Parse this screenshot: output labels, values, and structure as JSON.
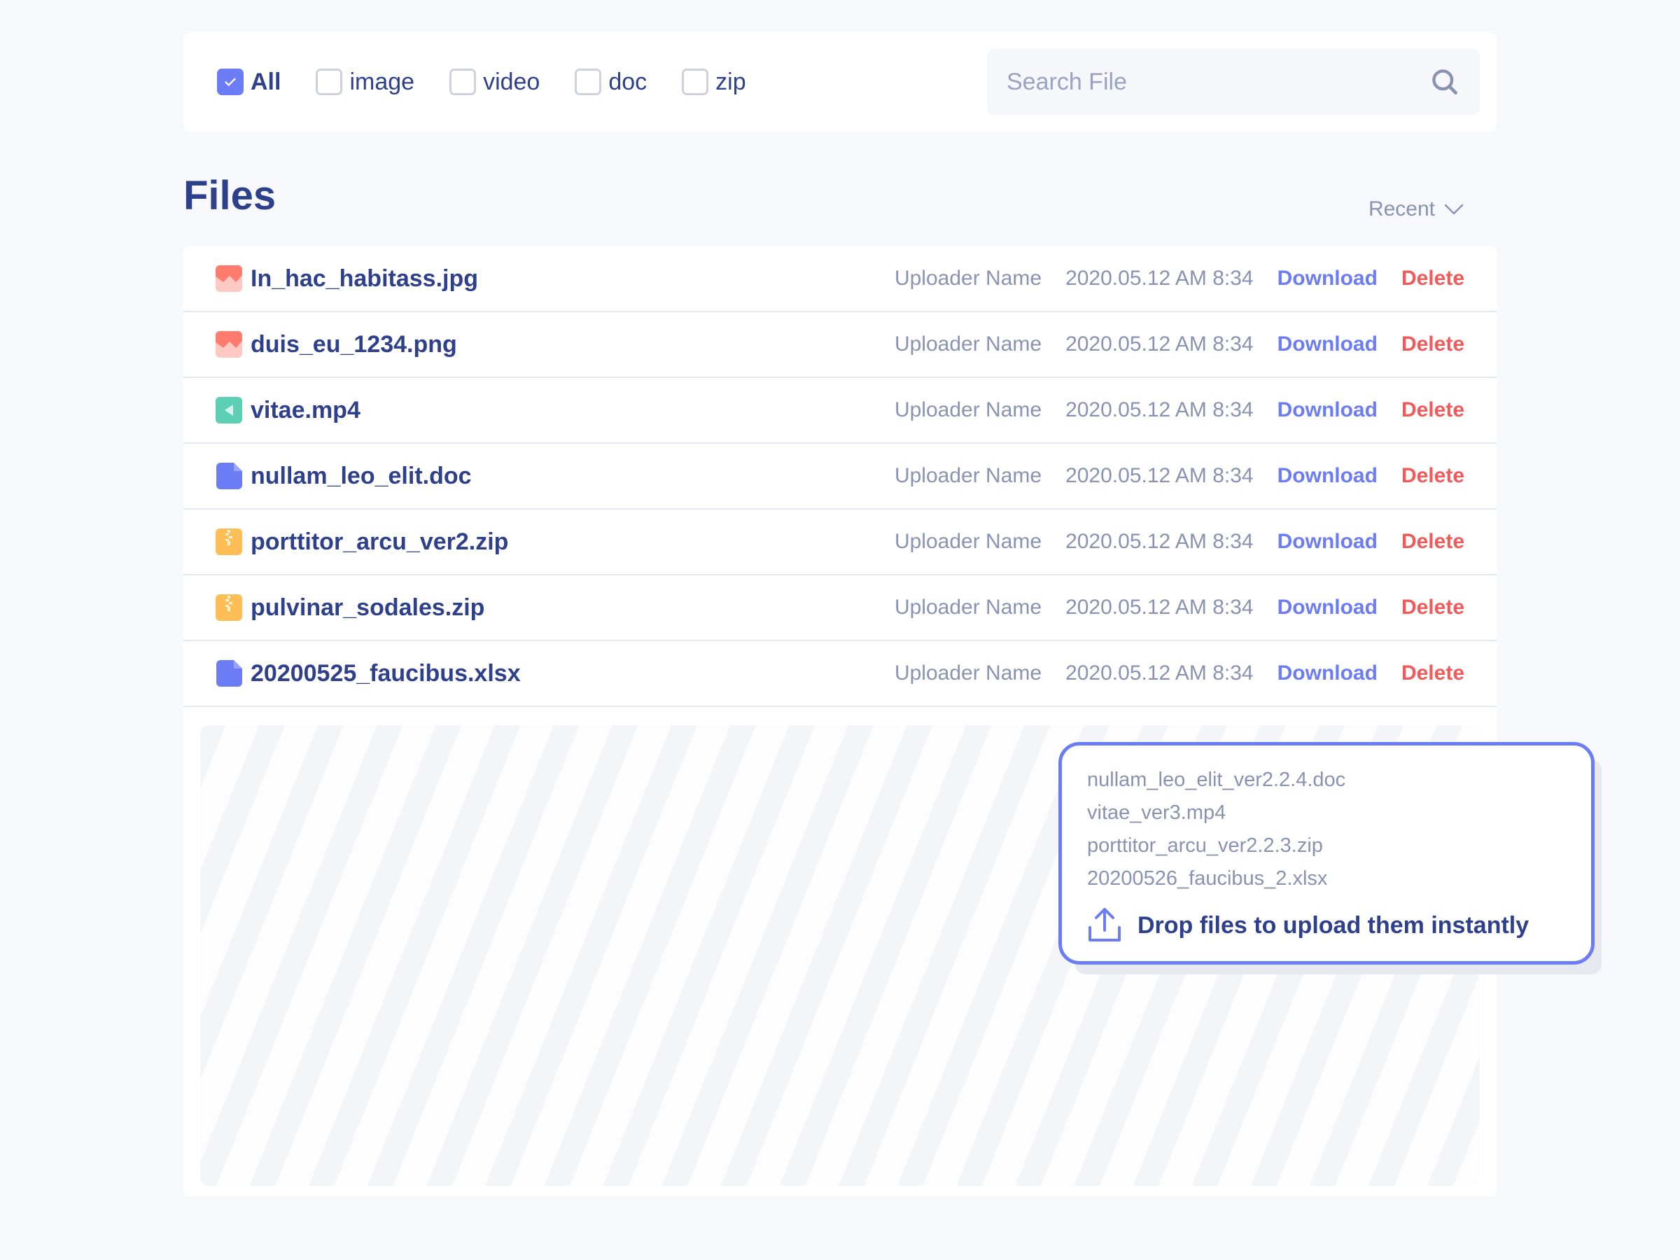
{
  "filters": [
    {
      "label": "All",
      "checked": true
    },
    {
      "label": "image",
      "checked": false
    },
    {
      "label": "video",
      "checked": false
    },
    {
      "label": "doc",
      "checked": false
    },
    {
      "label": "zip",
      "checked": false
    }
  ],
  "search": {
    "placeholder": "Search File",
    "value": "",
    "icon": "search-icon"
  },
  "header": {
    "title": "Files",
    "sort_label": "Recent",
    "sort_icon": "chevron-down-icon"
  },
  "colors": {
    "accent": "#6b7cf5",
    "text_primary": "#2e3f8c",
    "text_muted": "#8a92b2",
    "danger": "#f05a5a",
    "image_icon": "#ff7b6e",
    "video_icon": "#5ccfb4",
    "doc_icon": "#6b7cf5",
    "zip_icon": "#ffbe55"
  },
  "files": [
    {
      "name": "In_hac_habitass.jpg",
      "type": "image",
      "uploader": "Uploader Name",
      "date": "2020.05.12 AM 8:34",
      "download": "Download",
      "delete": "Delete"
    },
    {
      "name": "duis_eu_1234.png",
      "type": "image",
      "uploader": "Uploader Name",
      "date": "2020.05.12 AM 8:34",
      "download": "Download",
      "delete": "Delete"
    },
    {
      "name": "vitae.mp4",
      "type": "video",
      "uploader": "Uploader Name",
      "date": "2020.05.12 AM 8:34",
      "download": "Download",
      "delete": "Delete"
    },
    {
      "name": "nullam_leo_elit.doc",
      "type": "doc",
      "uploader": "Uploader Name",
      "date": "2020.05.12 AM 8:34",
      "download": "Download",
      "delete": "Delete"
    },
    {
      "name": "porttitor_arcu_ver2.zip",
      "type": "zip",
      "uploader": "Uploader Name",
      "date": "2020.05.12 AM 8:34",
      "download": "Download",
      "delete": "Delete"
    },
    {
      "name": "pulvinar_sodales.zip",
      "type": "zip",
      "uploader": "Uploader Name",
      "date": "2020.05.12 AM 8:34",
      "download": "Download",
      "delete": "Delete"
    },
    {
      "name": "20200525_faucibus.xlsx",
      "type": "doc",
      "uploader": "Uploader Name",
      "date": "2020.05.12 AM 8:34",
      "download": "Download",
      "delete": "Delete"
    }
  ],
  "dropzone": {
    "pending_files": [
      "nullam_leo_elit_ver2.2.4.doc",
      "vitae_ver3.mp4",
      "porttitor_arcu_ver2.2.3.zip",
      "20200526_faucibus_2.xlsx"
    ],
    "message": "Drop files to upload them instantly",
    "icon": "upload-icon"
  }
}
